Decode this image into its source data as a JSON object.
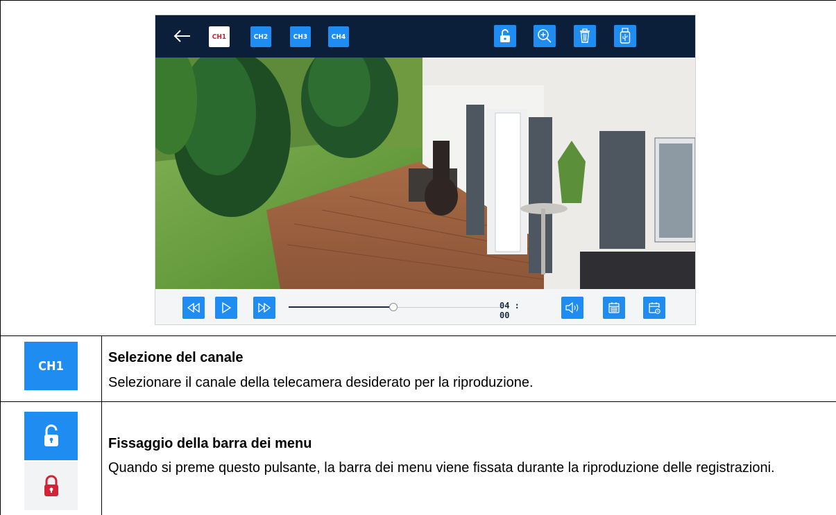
{
  "device": {
    "channels": [
      "CH1",
      "CH2",
      "CH3",
      "CH4"
    ],
    "active_channel": "CH1",
    "top_icons": [
      "lock-open-icon",
      "zoom-in-icon",
      "trash-icon",
      "usb-icon"
    ],
    "bottom_left_icons": [
      "rewind-icon",
      "play-icon",
      "fast-forward-icon"
    ],
    "bottom_right_icons": [
      "volume-icon",
      "calendar-icon",
      "calendar-clock-icon"
    ],
    "progress": 0.49,
    "time": "04 : 00"
  },
  "rows": [
    {
      "icon_label": "CH1",
      "title": "Selezione del canale",
      "text": "Selezionare il canale della telecamera desiderato per la riproduzione."
    },
    {
      "icons": [
        "lock-open-icon",
        "lock-closed-icon"
      ],
      "title": "Fissaggio della barra dei menu",
      "text": "Quando si preme questo pulsante, la barra dei menu viene fissata durante la riproduzione delle registrazioni."
    }
  ],
  "colors": {
    "accent": "#1e8cf0",
    "topbar": "#0b1f3a",
    "lock_red": "#d42236"
  }
}
